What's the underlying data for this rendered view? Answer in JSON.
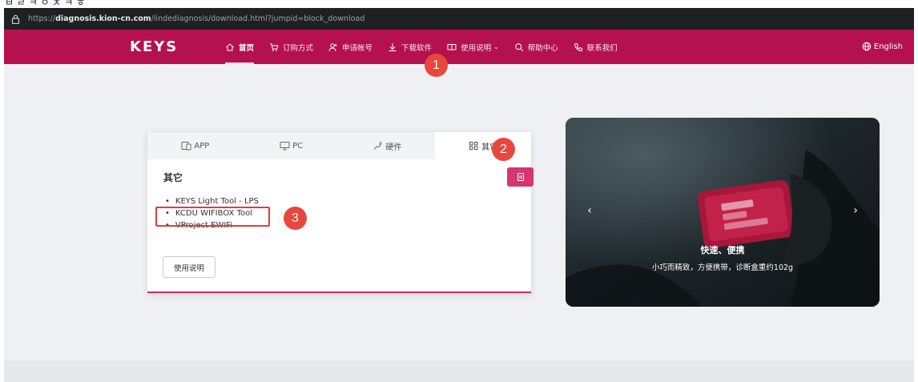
{
  "top_strip": {
    "text": "ㅂ ㄹ ㅋ ㅇ ㅊ ㅋ ㅎ"
  },
  "browser": {
    "url_scheme": "https://",
    "url_host": "diagnosis.kion-cn.com",
    "url_path": "/lindediagnosis/download.html?jumpid=block_download"
  },
  "nav": {
    "logo": "KEYS",
    "items": [
      {
        "label": "首页",
        "icon": "home-icon",
        "active": true
      },
      {
        "label": "订购方式",
        "icon": "cart-icon",
        "active": false
      },
      {
        "label": "申请帐号",
        "icon": "add-user-icon",
        "active": false
      },
      {
        "label": "下载软件",
        "icon": "download-icon",
        "active": false
      },
      {
        "label": "使用说明",
        "icon": "book-icon",
        "active": false
      },
      {
        "label": "帮助中心",
        "icon": "search-icon",
        "active": false
      },
      {
        "label": "联系我们",
        "icon": "phone-icon",
        "active": false
      }
    ],
    "language": "English"
  },
  "download_card": {
    "tabs": [
      {
        "label": "APP",
        "icon": "mobile-icon"
      },
      {
        "label": "PC",
        "icon": "monitor-icon"
      },
      {
        "label": "硬件",
        "icon": "hardware-icon"
      },
      {
        "label": "其它",
        "icon": "grid-icon",
        "active": true
      }
    ],
    "heading": "其它",
    "items": [
      "KEYS Light Tool - LPS",
      "KCDU WIFIBOX Tool",
      "VProject EWIFi"
    ],
    "manual_button": "使用说明"
  },
  "annotations": {
    "badge_1": "1",
    "badge_2": "2",
    "badge_3": "3"
  },
  "carousel": {
    "title": "快速、便携",
    "subtitle": "小巧而精致，方便携带，诊断盒重约102g",
    "prev": "‹",
    "next": "›"
  },
  "colors": {
    "brand": "#b5114f",
    "accent": "#d5376d",
    "annotation": "#e8473d"
  }
}
